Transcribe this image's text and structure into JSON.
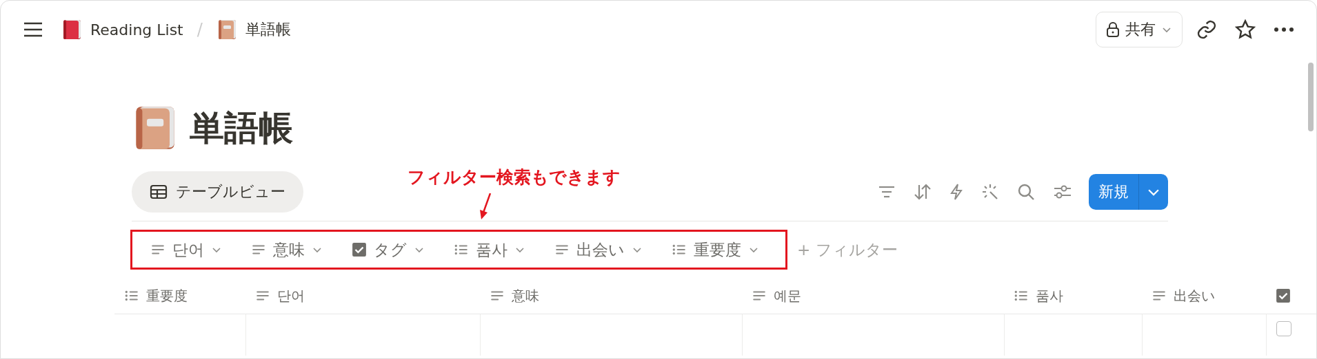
{
  "breadcrumb": [
    {
      "label": "Reading List",
      "kind": "red-book"
    },
    {
      "label": "単語帳",
      "kind": "brown-book"
    }
  ],
  "breadcrumb_separator": "/",
  "share_button": {
    "label": "共有"
  },
  "page": {
    "title": "単語帳"
  },
  "view_tab": {
    "label": "テーブルビュー"
  },
  "annotation": {
    "text": "フィルター検索もできます"
  },
  "new_button": {
    "label": "新規"
  },
  "filters": [
    {
      "label": "단어",
      "kind": "text"
    },
    {
      "label": "意味",
      "kind": "text"
    },
    {
      "label": "タグ",
      "kind": "checkbox"
    },
    {
      "label": "품사",
      "kind": "list"
    },
    {
      "label": "出会い",
      "kind": "text"
    },
    {
      "label": "重要度",
      "kind": "list"
    }
  ],
  "add_filter": {
    "label": "+ フィルター"
  },
  "table": {
    "columns": [
      {
        "label": "重要度",
        "kind": "list"
      },
      {
        "label": "단어",
        "kind": "text"
      },
      {
        "label": "意味",
        "kind": "text"
      },
      {
        "label": "예문",
        "kind": "text"
      },
      {
        "label": "품사",
        "kind": "list"
      },
      {
        "label": "出会い",
        "kind": "text"
      },
      {
        "kind": "checkbox"
      }
    ],
    "rows": [
      {
        "checked": false
      }
    ]
  }
}
